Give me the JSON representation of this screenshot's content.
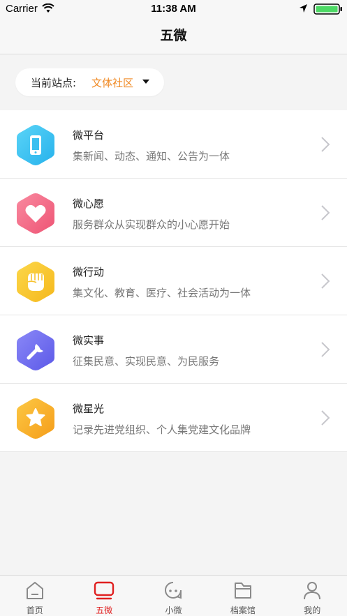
{
  "status_bar": {
    "carrier": "Carrier",
    "time": "11:38 AM"
  },
  "nav": {
    "title": "五微"
  },
  "site": {
    "label": "当前站点:",
    "value": "文体社区"
  },
  "menu": [
    {
      "title": "微平台",
      "desc": "集新闻、动态、通知、公告为一体",
      "icon": "phone-icon",
      "color": "#35c3f0"
    },
    {
      "title": "微心愿",
      "desc": "服务群众从实现群众的小心愿开始",
      "icon": "heart-icon",
      "color": "#f06a86"
    },
    {
      "title": "微行动",
      "desc": "集文化、教育、医疗、社会活动为一体",
      "icon": "fist-icon",
      "color": "#f7c22e"
    },
    {
      "title": "微实事",
      "desc": "征集民意、实现民意、为民服务",
      "icon": "wrench-icon",
      "color": "#6f6cf0"
    },
    {
      "title": "微星光",
      "desc": "记录先进党组织、个人集党建文化品牌",
      "icon": "star-icon",
      "color": "#f7b32a"
    }
  ],
  "tabs": [
    {
      "label": "首页",
      "icon": "home-icon",
      "active": false
    },
    {
      "label": "五微",
      "icon": "tv-icon",
      "active": true
    },
    {
      "label": "小微",
      "icon": "chat-bot-icon",
      "active": false
    },
    {
      "label": "档案馆",
      "icon": "folder-icon",
      "active": false
    },
    {
      "label": "我的",
      "icon": "user-icon",
      "active": false
    }
  ],
  "colors": {
    "accent": "#f08a24",
    "active_tab": "#e02020"
  }
}
